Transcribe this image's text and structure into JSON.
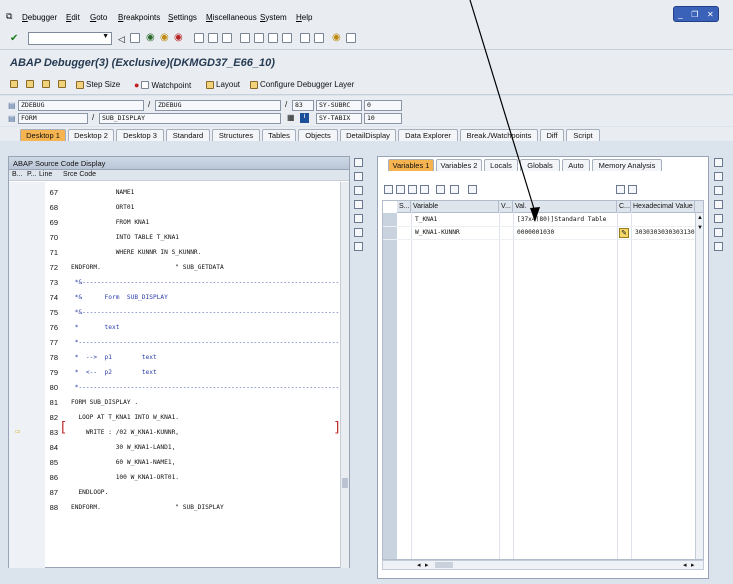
{
  "menu": [
    "Debugger",
    "Edit",
    "Goto",
    "Breakpoints",
    "Settings",
    "Miscellaneous",
    "System",
    "Help"
  ],
  "window_title": "ABAP Debugger(3) (Exclusive)(DKMGD37_E66_10)",
  "app_toolbar": {
    "step_size": "Step Size",
    "watchpoint": "Watchpoint",
    "layout": "Layout",
    "configure": "Configure Debugger Layer"
  },
  "fields": {
    "row1": {
      "program": "ZDEBUG",
      "include": "ZDEBUG",
      "line": "83",
      "sysvar": "SY-SUBRC",
      "sysval": "0"
    },
    "row2": {
      "event_type": "FORM",
      "event": "SUB_DISPLAY",
      "sysvar": "SY-TABIX",
      "sysval": "10"
    }
  },
  "tabs": [
    "Desktop 1",
    "Desktop 2",
    "Desktop 3",
    "Standard",
    "Structures",
    "Tables",
    "Objects",
    "DetailDisplay",
    "Data Explorer",
    "Break./Watchpoints",
    "Diff",
    "Script"
  ],
  "active_tab": "Desktop 1",
  "source": {
    "panel_title": "ABAP Source Code Display",
    "col_b": "B...",
    "col_p": "P...",
    "col_line": "Line",
    "col_src": "Srce Code",
    "current_marker": "⇨",
    "lines": [
      {
        "n": "67",
        "code": "            NAME1",
        "comment": false
      },
      {
        "n": "68",
        "code": "            ORT01",
        "comment": false
      },
      {
        "n": "69",
        "code": "            FROM KNA1",
        "comment": false
      },
      {
        "n": "70",
        "code": "            INTO TABLE T_KNA1",
        "comment": false
      },
      {
        "n": "71",
        "code": "            WHERE KUNNR IN S_KUNNR.",
        "comment": false
      },
      {
        "n": "72",
        "code": "ENDFORM.                    \" SUB_GETDATA",
        "comment": false
      },
      {
        "n": "73",
        "code": " *&---------------------------------------------------------------------",
        "comment": true
      },
      {
        "n": "74",
        "code": " *&      Form  SUB_DISPLAY",
        "comment": true
      },
      {
        "n": "75",
        "code": " *&---------------------------------------------------------------------",
        "comment": true
      },
      {
        "n": "76",
        "code": " *       text",
        "comment": true
      },
      {
        "n": "77",
        "code": " *----------------------------------------------------------------------",
        "comment": true
      },
      {
        "n": "78",
        "code": " *  -->  p1        text",
        "comment": true
      },
      {
        "n": "79",
        "code": " *  <--  p2        text",
        "comment": true
      },
      {
        "n": "80",
        "code": " *----------------------------------------------------------------------",
        "comment": true
      },
      {
        "n": "81",
        "code": "FORM SUB_DISPLAY .",
        "comment": false
      },
      {
        "n": "82",
        "code": "  LOOP AT T_KNA1 INTO W_KNA1.",
        "comment": false
      },
      {
        "n": "83",
        "code": "    WRITE : /02 W_KNA1-KUNNR,",
        "comment": false
      },
      {
        "n": "84",
        "code": "            30 W_KNA1-LAND1,",
        "comment": false
      },
      {
        "n": "85",
        "code": "            60 W_KNA1-NAME1,",
        "comment": false
      },
      {
        "n": "86",
        "code": "            100 W_KNA1-ORT01.",
        "comment": false
      },
      {
        "n": "87",
        "code": "  ENDLOOP.",
        "comment": false
      },
      {
        "n": "88",
        "code": "ENDFORM.                    \" SUB_DISPLAY",
        "comment": false
      }
    ]
  },
  "variables": {
    "tabs": [
      "Variables 1",
      "Variables 2",
      "Locals",
      "Globals",
      "Auto",
      "Memory Analysis"
    ],
    "active_tab": "Variables 1",
    "headers": {
      "s": "S...",
      "variable": "Variable",
      "v": "V...",
      "val": "Val.",
      "c": "C...",
      "hex": "Hexadecimal Value"
    },
    "rows": [
      {
        "variable": "T_KNA1",
        "value": "[37x4(80)]Standard Table",
        "hex": ""
      },
      {
        "variable": "W_KNA1-KUNNR",
        "value": "0000001030",
        "hex": "30303030303031303"
      }
    ]
  },
  "colors": {
    "active_tab": "#f6b450",
    "title_text": "#263a52",
    "comment": "#2d3fa8"
  }
}
